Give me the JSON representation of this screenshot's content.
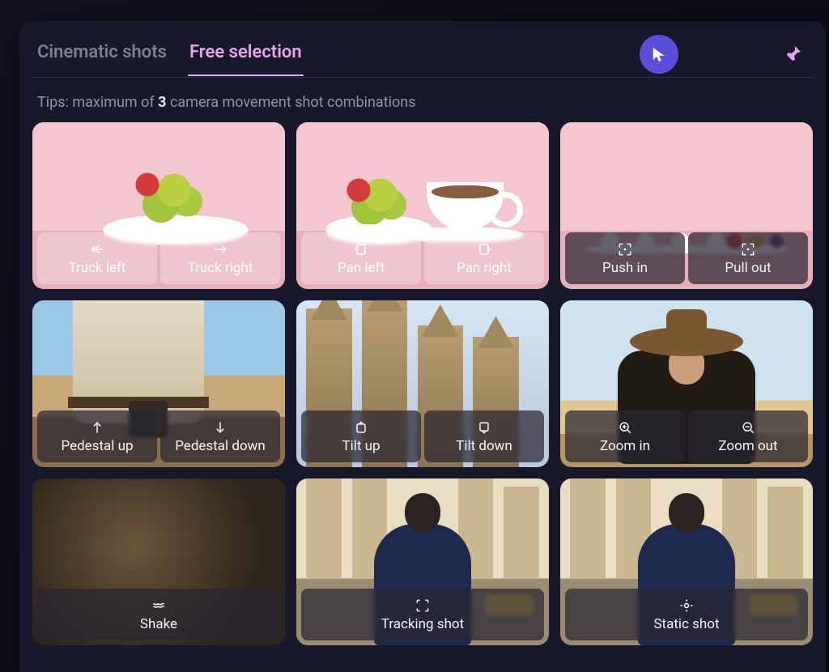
{
  "tabs": {
    "cinematic": "Cinematic shots",
    "free": "Free selection"
  },
  "active_tab": "free",
  "tips_prefix": "Tips:  maximum of ",
  "tips_bold": "3",
  "tips_suffix": " camera movement shot combinations",
  "cards": [
    {
      "selected": true,
      "options": [
        "Truck left",
        "Truck right"
      ],
      "icons": [
        "arrow-left-icon",
        "arrow-right-icon"
      ],
      "scene": "fruit",
      "light": true
    },
    {
      "selected": true,
      "options": [
        "Pan left",
        "Pan right"
      ],
      "icons": [
        "pan-left-icon",
        "pan-right-icon"
      ],
      "scene": "fruit-cup",
      "light": true
    },
    {
      "selected": false,
      "options": [
        "Push in",
        "Pull out"
      ],
      "icons": [
        "push-in-icon",
        "pull-out-icon"
      ],
      "scene": "fruit-far",
      "light": false
    },
    {
      "selected": false,
      "options": [
        "Pedestal up",
        "Pedestal down"
      ],
      "icons": [
        "arrow-up-icon",
        "arrow-down-icon"
      ],
      "scene": "cowboy-waist",
      "light": false
    },
    {
      "selected": false,
      "options": [
        "Tilt up",
        "Tilt down"
      ],
      "icons": [
        "tilt-up-icon",
        "tilt-down-icon"
      ],
      "scene": "cathedral",
      "light": false
    },
    {
      "selected": false,
      "options": [
        "Zoom in",
        "Zoom out"
      ],
      "icons": [
        "zoom-in-icon",
        "zoom-out-icon"
      ],
      "scene": "cowboy",
      "light": false
    },
    {
      "selected": false,
      "options": [
        "Shake"
      ],
      "icons": [
        "shake-icon"
      ],
      "scene": "blur",
      "light": false
    },
    {
      "selected": false,
      "options": [
        "Tracking shot"
      ],
      "icons": [
        "tracking-icon"
      ],
      "scene": "city",
      "light": false
    },
    {
      "selected": false,
      "options": [
        "Static shot"
      ],
      "icons": [
        "static-icon"
      ],
      "scene": "city",
      "light": false
    }
  ]
}
